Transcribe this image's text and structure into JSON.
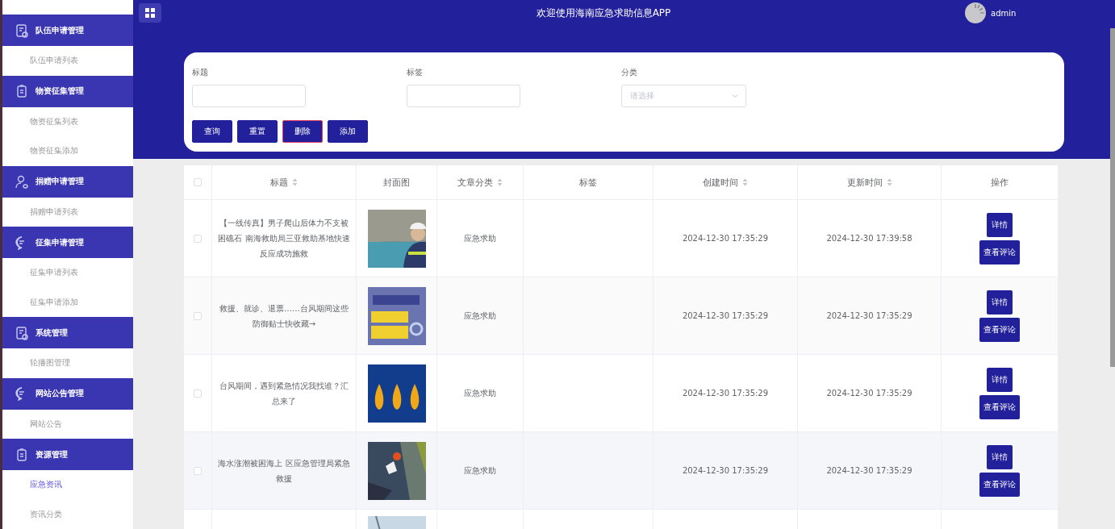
{
  "header": {
    "title": "欢迎使用海南应急求助信息APP",
    "user": "admin"
  },
  "sidebar": {
    "groups": [
      {
        "label": "队伍申请管理",
        "kind": "form",
        "items": [
          {
            "label": "队伍申请列表",
            "selected": false
          }
        ]
      },
      {
        "label": "物资征集管理",
        "kind": "list",
        "items": [
          {
            "label": "物资征集列表",
            "selected": false
          },
          {
            "label": "物资征集添加",
            "selected": false
          }
        ]
      },
      {
        "label": "捐赠申请管理",
        "kind": "person",
        "items": [
          {
            "label": "捐赠申请列表",
            "selected": false
          }
        ]
      },
      {
        "label": "征集申请管理",
        "kind": "message",
        "items": [
          {
            "label": "征集申请列表",
            "selected": false
          },
          {
            "label": "征集申请添加",
            "selected": false
          }
        ]
      },
      {
        "label": "系统管理",
        "kind": "form",
        "items": [
          {
            "label": "轮播图管理",
            "selected": false
          }
        ]
      },
      {
        "label": "网站公告管理",
        "kind": "message",
        "items": [
          {
            "label": "网站公告",
            "selected": false
          }
        ]
      },
      {
        "label": "资源管理",
        "kind": "list",
        "items": [
          {
            "label": "应急资讯",
            "selected": true
          },
          {
            "label": "资讯分类",
            "selected": false
          }
        ]
      }
    ]
  },
  "search": {
    "fields": [
      {
        "label": "标题",
        "kind": "input"
      },
      {
        "label": "标签",
        "kind": "input"
      },
      {
        "label": "分类",
        "kind": "select",
        "placeholder": "请选择"
      }
    ],
    "buttons": [
      {
        "label": "查询",
        "focused": false
      },
      {
        "label": "重置",
        "focused": false
      },
      {
        "label": "删除",
        "focused": true
      },
      {
        "label": "添加",
        "focused": false
      }
    ]
  },
  "table": {
    "all_checked": false,
    "columns": [
      {
        "label": "标题",
        "sortable": true
      },
      {
        "label": "封面图",
        "sortable": false
      },
      {
        "label": "文章分类",
        "sortable": true
      },
      {
        "label": "标签",
        "sortable": false
      },
      {
        "label": "创建时间",
        "sortable": true
      },
      {
        "label": "更新时间",
        "sortable": true
      },
      {
        "label": "操作",
        "sortable": false
      }
    ],
    "rows": [
      {
        "checked": false,
        "title": "【一线传真】男子爬山后体力不支被困礁石 南海救助局三亚救助基地快速反应成功施救",
        "category": "应急求助",
        "created": "2024-12-30 17:35:29",
        "updated": "2024-12-30 17:39:58",
        "actions": [
          "详情",
          "查看评论"
        ]
      },
      {
        "checked": false,
        "title": "救援、就诊、退票……台风期间这些防御贴士快收藏→",
        "category": "应急求助",
        "created": "2024-12-30 17:35:29",
        "updated": "2024-12-30 17:35:29",
        "actions": [
          "详情",
          "查看评论"
        ]
      },
      {
        "checked": false,
        "title": "台风期间，遇到紧急情况我找谁？汇总来了",
        "category": "应急求助",
        "created": "2024-12-30 17:35:29",
        "updated": "2024-12-30 17:35:29",
        "actions": [
          "详情",
          "查看评论"
        ]
      },
      {
        "checked": false,
        "title": "海水涨潮被困海上 区应急管理局紧急救援",
        "category": "应急求助",
        "created": "2024-12-30 17:35:29",
        "updated": "2024-12-30 17:35:29",
        "actions": [
          "详情",
          "查看评论"
        ]
      }
    ]
  }
}
